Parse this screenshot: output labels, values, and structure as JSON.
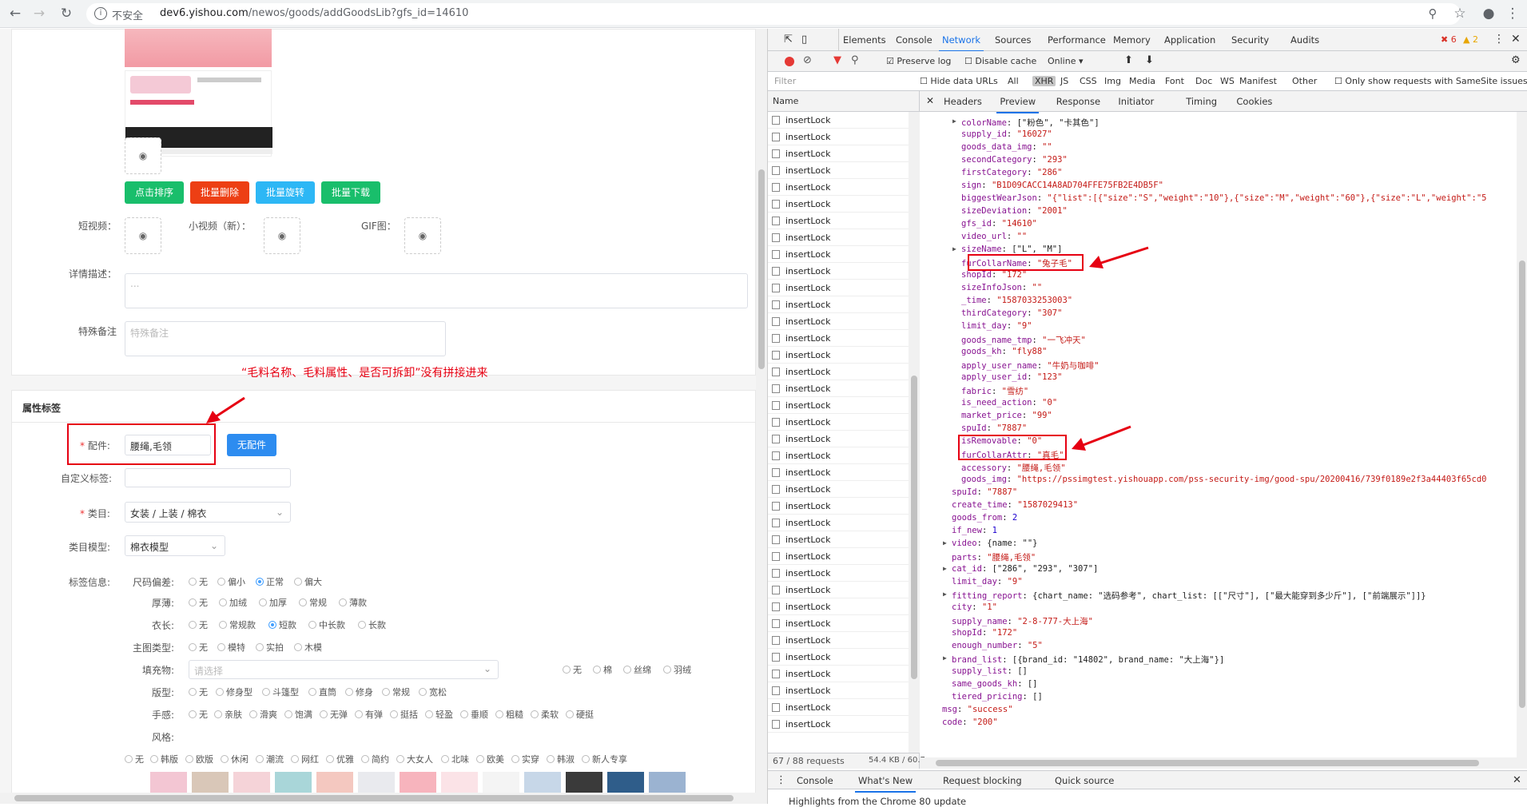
{
  "browser": {
    "insecure_label": "不安全",
    "url_host": "dev6.yishou.com",
    "url_path": "/newos/goods/addGoodsLib?gfs_id=14610"
  },
  "form": {
    "batch_buttons": [
      {
        "label": "点击排序",
        "color": "#19be6b"
      },
      {
        "label": "批量删除",
        "color": "#ed3f14"
      },
      {
        "label": "批量旋转",
        "color": "#2db7f5"
      },
      {
        "label": "批量下载",
        "color": "#19be6b"
      }
    ],
    "short_video_label": "短视频：",
    "small_video_label": "小视频（新）：",
    "gif_label": "GIF图：",
    "detail_label": "详情描述：",
    "detail_placeholder": "...",
    "remark_label": "特殊备注",
    "remark_placeholder": "特殊备注",
    "annotation_note": "“毛料名称、毛料属性、是否可拆卸”没有拼接进来",
    "section_title": "属性标签",
    "accessory_label": "配件:",
    "accessory_value": "腰绳,毛领",
    "no_accessory_button": "无配件",
    "custom_tag_label": "自定义标签:",
    "category_label": "类目:",
    "category_value": "女装 / 上装 / 棉衣",
    "category_model_label": "类目模型:",
    "category_model_value": "棉衣模型",
    "tag_info_label": "标签信息:",
    "size_deviation_label": "尺码偏差:",
    "size_deviation_options": [
      "无",
      "偏小",
      "正常",
      "偏大"
    ],
    "thickness_label": "厚薄:",
    "thickness_options": [
      "无",
      "加绒",
      "加厚",
      "常规",
      "薄款"
    ],
    "length_label": "衣长:",
    "length_options": [
      "无",
      "常规款",
      "短款",
      "中长款",
      "长款"
    ],
    "main_pic_label": "主图类型:",
    "main_pic_options": [
      "无",
      "模特",
      "实拍",
      "木模"
    ],
    "filler_label": "填充物:",
    "filler_placeholder": "请选择",
    "filler_options": [
      "无",
      "棉",
      "丝绵",
      "羽绒"
    ],
    "fit_label": "版型:",
    "fit_options": [
      "无",
      "修身型",
      "斗篷型",
      "直筒",
      "修身",
      "常规",
      "宽松"
    ],
    "feel_label": "手感:",
    "feel_options": [
      "无",
      "亲肤",
      "滑爽",
      "饱满",
      "无弹",
      "有弹",
      "挺括",
      "轻盈",
      "垂顺",
      "粗糙",
      "柔软",
      "硬挺"
    ],
    "style_label": "风格:",
    "style_options": [
      "无",
      "韩版",
      "欧版",
      "休闲",
      "潮流",
      "网红",
      "优雅",
      "简约",
      "大女人",
      "北味",
      "欧美",
      "实穿",
      "韩淑",
      "新人专享"
    ]
  },
  "devtools": {
    "tabs": [
      "Elements",
      "Console",
      "Network",
      "Sources",
      "Performance",
      "Memory",
      "Application",
      "Security",
      "Audits"
    ],
    "active_tab": "Network",
    "errors": "6",
    "warnings": "2",
    "preserve_log": "Preserve log",
    "disable_cache": "Disable cache",
    "throttle": "Online",
    "filter_placeholder": "Filter",
    "hide_data_urls": "Hide data URLs",
    "types": [
      "All",
      "XHR",
      "JS",
      "CSS",
      "Img",
      "Media",
      "Font",
      "Doc",
      "WS",
      "Manifest",
      "Other"
    ],
    "samesite": "Only show requests with SameSite issues",
    "name_header": "Name",
    "request_name": "insertLock",
    "detail_tabs": [
      "Headers",
      "Preview",
      "Response",
      "Initiator",
      "Timing",
      "Cookies"
    ],
    "active_detail_tab": "Preview",
    "status_requests": "67 / 88 requests",
    "status_size": "54.4 KB / 60.7",
    "drawer_tabs": [
      "Console",
      "What's New",
      "Request blocking",
      "Quick source"
    ],
    "drawer_message": "Highlights from the Chrome 80 update"
  },
  "preview_lines": [
    {
      "indent": 1,
      "tri": true,
      "key": "colorName",
      "val": "[\"粉色\", \"卡其色\"]",
      "t": "plain"
    },
    {
      "indent": 1,
      "key": "supply_id",
      "val": "\"16027\"",
      "t": "str"
    },
    {
      "indent": 1,
      "key": "goods_data_img",
      "val": "\"\"",
      "t": "str"
    },
    {
      "indent": 1,
      "key": "secondCategory",
      "val": "\"293\"",
      "t": "str"
    },
    {
      "indent": 1,
      "key": "firstCategory",
      "val": "\"286\"",
      "t": "str"
    },
    {
      "indent": 1,
      "key": "sign",
      "val": "\"B1D09CACC14A8AD704FFE75FB2E4DB5F\"",
      "t": "str"
    },
    {
      "indent": 1,
      "key": "biggestWearJson",
      "val": "\"{\"list\":[{\"size\":\"S\",\"weight\":\"10\"},{\"size\":\"M\",\"weight\":\"60\"},{\"size\":\"L\",\"weight\":\"5",
      "t": "str"
    },
    {
      "indent": 1,
      "key": "sizeDeviation",
      "val": "\"2001\"",
      "t": "str"
    },
    {
      "indent": 1,
      "key": "gfs_id",
      "val": "\"14610\"",
      "t": "str"
    },
    {
      "indent": 1,
      "key": "video_url",
      "val": "\"\"",
      "t": "str"
    },
    {
      "indent": 1,
      "tri": true,
      "key": "sizeName",
      "val": "[\"L\", \"M\"]",
      "t": "plain"
    },
    {
      "indent": 1,
      "key": "furCollarName",
      "val": "\"兔子毛\"",
      "t": "str"
    },
    {
      "indent": 1,
      "key": "shopId",
      "val": "\"172\"",
      "t": "str"
    },
    {
      "indent": 1,
      "key": "sizeInfoJson",
      "val": "\"\"",
      "t": "str"
    },
    {
      "indent": 1,
      "key": "_time",
      "val": "\"1587033253003\"",
      "t": "str"
    },
    {
      "indent": 1,
      "key": "thirdCategory",
      "val": "\"307\"",
      "t": "str"
    },
    {
      "indent": 1,
      "key": "limit_day",
      "val": "\"9\"",
      "t": "str"
    },
    {
      "indent": 1,
      "key": "goods_name_tmp",
      "val": "\"一飞冲天\"",
      "t": "str"
    },
    {
      "indent": 1,
      "key": "goods_kh",
      "val": "\"fly88\"",
      "t": "str"
    },
    {
      "indent": 1,
      "key": "apply_user_name",
      "val": "\"牛奶与咖啡\"",
      "t": "str"
    },
    {
      "indent": 1,
      "key": "apply_user_id",
      "val": "\"123\"",
      "t": "str"
    },
    {
      "indent": 1,
      "key": "fabric",
      "val": "\"雪纺\"",
      "t": "str"
    },
    {
      "indent": 1,
      "key": "is_need_action",
      "val": "\"0\"",
      "t": "str"
    },
    {
      "indent": 1,
      "key": "market_price",
      "val": "\"99\"",
      "t": "str"
    },
    {
      "indent": 1,
      "key": "spuId",
      "val": "\"7887\"",
      "t": "str"
    },
    {
      "indent": 1,
      "key": "isRemovable",
      "val": "\"0\"",
      "t": "str"
    },
    {
      "indent": 1,
      "key": "furCollarAttr",
      "val": "\"真毛\"",
      "t": "str"
    },
    {
      "indent": 1,
      "key": "accessory",
      "val": "\"腰绳,毛领\"",
      "t": "str"
    },
    {
      "indent": 1,
      "key": "goods_img",
      "val": "\"https://pssimgtest.yishouapp.com/pss-security-img/good-spu/20200416/739f0189e2f3a44403f65cd0",
      "t": "str"
    },
    {
      "indent": 0,
      "key": "spuId",
      "val": "\"7887\"",
      "t": "str"
    },
    {
      "indent": 0,
      "key": "create_time",
      "val": "\"1587029413\"",
      "t": "str"
    },
    {
      "indent": 0,
      "key": "goods_from",
      "val": "2",
      "t": "num"
    },
    {
      "indent": 0,
      "key": "if_new",
      "val": "1",
      "t": "num"
    },
    {
      "indent": 0,
      "tri": true,
      "key": "video",
      "val": "{name: \"\"}",
      "t": "plain"
    },
    {
      "indent": 0,
      "key": "parts",
      "val": "\"腰绳,毛领\"",
      "t": "str"
    },
    {
      "indent": 0,
      "tri": true,
      "key": "cat_id",
      "val": "[\"286\", \"293\", \"307\"]",
      "t": "plain"
    },
    {
      "indent": 0,
      "key": "limit_day",
      "val": "\"9\"",
      "t": "str"
    },
    {
      "indent": 0,
      "tri": true,
      "key": "fitting_report",
      "val": "{chart_name: \"选码参考\", chart_list: [[\"尺寸\"], [\"最大能穿到多少斤\"], [\"前端展示\"]]}",
      "t": "plain"
    },
    {
      "indent": 0,
      "key": "city",
      "val": "\"1\"",
      "t": "str"
    },
    {
      "indent": 0,
      "key": "supply_name",
      "val": "\"2-8-777-大上海\"",
      "t": "str"
    },
    {
      "indent": 0,
      "key": "shopId",
      "val": "\"172\"",
      "t": "str"
    },
    {
      "indent": 0,
      "key": "enough_number",
      "val": "\"5\"",
      "t": "str"
    },
    {
      "indent": 0,
      "tri": true,
      "key": "brand_list",
      "val": "[{brand_id: \"14802\", brand_name: \"大上海\"}]",
      "t": "plain"
    },
    {
      "indent": 0,
      "key": "supply_list",
      "val": "[]",
      "t": "plain"
    },
    {
      "indent": 0,
      "key": "same_goods_kh",
      "val": "[]",
      "t": "plain"
    },
    {
      "indent": 0,
      "key": "tiered_pricing",
      "val": "[]",
      "t": "plain"
    },
    {
      "indent": -1,
      "key": "msg",
      "val": "\"success\"",
      "t": "str"
    },
    {
      "indent": -1,
      "key": "code",
      "val": "\"200\"",
      "t": "str"
    }
  ]
}
